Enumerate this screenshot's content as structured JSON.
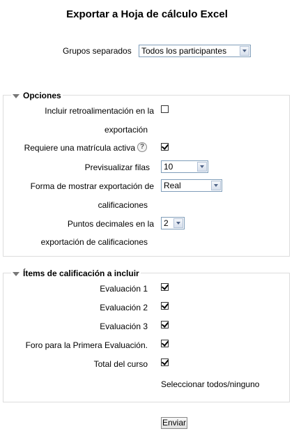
{
  "page": {
    "title": "Exportar a Hoja de cálculo Excel"
  },
  "groups": {
    "label": "Grupos separados",
    "selected": "Todos los participantes"
  },
  "options": {
    "legend": "Opciones",
    "feedback": {
      "label_line1": "Incluir retroalimentación en la",
      "label_line2": "exportación",
      "checked": false
    },
    "active_enrol": {
      "label": "Requiere una matrícula activa",
      "checked": true
    },
    "preview_rows": {
      "label": "Previsualizar filas",
      "selected": "10"
    },
    "display_type": {
      "label_line1": "Forma de mostrar exportación de",
      "label_line2": "calificaciones",
      "selected": "Real"
    },
    "decimal_points": {
      "label_line1": "Puntos decimales en la",
      "label_line2": "exportación de calificaciones",
      "selected": "2"
    }
  },
  "grade_items": {
    "legend": "Ítems de calificación a incluir",
    "items": [
      {
        "label": "Evaluación 1",
        "checked": true
      },
      {
        "label": "Evaluación 2",
        "checked": true
      },
      {
        "label": "Evaluación 3",
        "checked": true
      },
      {
        "label": "Foro para la Primera Evaluación.",
        "checked": true
      },
      {
        "label": "Total del curso",
        "checked": true
      }
    ],
    "select_all_link": "Seleccionar todos/ninguno"
  },
  "submit": {
    "label": "Enviar"
  }
}
